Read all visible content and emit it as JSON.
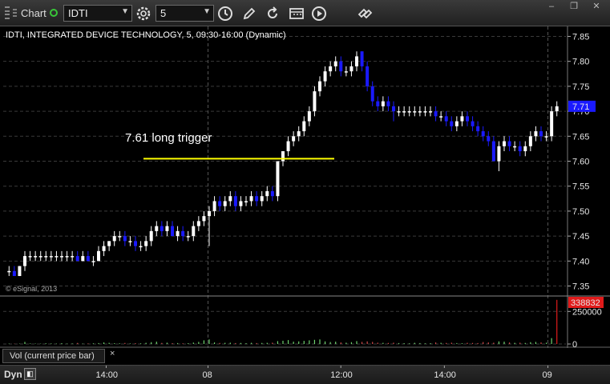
{
  "toolbar": {
    "chart_label": "Chart",
    "symbol": "IDTI",
    "interval": "5",
    "icons": [
      "gear-icon",
      "clock-icon",
      "pencil-icon",
      "refresh-icon",
      "calendar-icon",
      "play-icon",
      "link-icon"
    ]
  },
  "chart": {
    "title": "IDTI, INTEGRATED DEVICE TECHNOLOGY, 5, 09:30-16:00 (Dynamic)",
    "copyright": "© eSignal, 2013",
    "annotation": "7.61 long trigger",
    "current_price_label": "7.71",
    "volume_max_label": "338832",
    "volume_title": "Vol (current price bar)",
    "volume_close": "×",
    "dyn_label": "Dyn",
    "dyn_button": "◧"
  },
  "colors": {
    "background": "#000000",
    "up_candle": "#ffffff",
    "down_candle": "#1a1aff",
    "trigger_line": "#ffff00",
    "grid": "#3a3a3a",
    "price_marker": "#1a1aff",
    "volume_marker": "#e01b1b"
  },
  "chart_data": {
    "type": "candlestick",
    "price_axis_ticks": [
      "7.85",
      "7.80",
      "7.75",
      "7.70",
      "7.65",
      "7.60",
      "7.55",
      "7.50",
      "7.45",
      "7.40",
      "7.35"
    ],
    "volume_axis_ticks": [
      "250000",
      "0"
    ],
    "time_axis_ticks": [
      "14:00",
      "08",
      "12:00",
      "14:00",
      "09"
    ],
    "price_range": [
      7.33,
      7.87
    ],
    "volume_range": [
      0,
      350000
    ],
    "trigger_price": 7.605,
    "last_price": 7.71,
    "candles": [
      [
        7.38,
        7.39,
        7.37,
        7.38
      ],
      [
        7.38,
        7.39,
        7.37,
        7.37
      ],
      [
        7.37,
        7.39,
        7.37,
        7.39
      ],
      [
        7.39,
        7.42,
        7.38,
        7.41
      ],
      [
        7.41,
        7.42,
        7.4,
        7.41
      ],
      [
        7.41,
        7.42,
        7.4,
        7.41
      ],
      [
        7.41,
        7.42,
        7.4,
        7.41
      ],
      [
        7.41,
        7.42,
        7.4,
        7.41
      ],
      [
        7.41,
        7.42,
        7.4,
        7.41
      ],
      [
        7.41,
        7.42,
        7.4,
        7.41
      ],
      [
        7.41,
        7.42,
        7.4,
        7.41
      ],
      [
        7.41,
        7.42,
        7.4,
        7.41
      ],
      [
        7.41,
        7.42,
        7.4,
        7.41
      ],
      [
        7.41,
        7.42,
        7.4,
        7.4
      ],
      [
        7.4,
        7.42,
        7.4,
        7.41
      ],
      [
        7.41,
        7.42,
        7.4,
        7.4
      ],
      [
        7.4,
        7.41,
        7.39,
        7.4
      ],
      [
        7.4,
        7.43,
        7.4,
        7.42
      ],
      [
        7.42,
        7.44,
        7.41,
        7.43
      ],
      [
        7.43,
        7.44,
        7.42,
        7.44
      ],
      [
        7.44,
        7.46,
        7.43,
        7.45
      ],
      [
        7.45,
        7.46,
        7.44,
        7.45
      ],
      [
        7.45,
        7.46,
        7.43,
        7.44
      ],
      [
        7.44,
        7.45,
        7.43,
        7.44
      ],
      [
        7.44,
        7.45,
        7.42,
        7.43
      ],
      [
        7.43,
        7.44,
        7.42,
        7.43
      ],
      [
        7.43,
        7.45,
        7.42,
        7.44
      ],
      [
        7.44,
        7.47,
        7.43,
        7.46
      ],
      [
        7.46,
        7.48,
        7.45,
        7.47
      ],
      [
        7.47,
        7.48,
        7.45,
        7.46
      ],
      [
        7.46,
        7.48,
        7.45,
        7.47
      ],
      [
        7.47,
        7.48,
        7.45,
        7.45
      ],
      [
        7.45,
        7.47,
        7.44,
        7.46
      ],
      [
        7.46,
        7.47,
        7.44,
        7.45
      ],
      [
        7.45,
        7.46,
        7.44,
        7.45
      ],
      [
        7.45,
        7.48,
        7.44,
        7.47
      ],
      [
        7.47,
        7.49,
        7.46,
        7.48
      ],
      [
        7.48,
        7.5,
        7.47,
        7.49
      ],
      [
        7.49,
        7.51,
        7.43,
        7.5
      ],
      [
        7.5,
        7.53,
        7.49,
        7.52
      ],
      [
        7.52,
        7.53,
        7.5,
        7.51
      ],
      [
        7.51,
        7.53,
        7.5,
        7.52
      ],
      [
        7.52,
        7.54,
        7.51,
        7.53
      ],
      [
        7.53,
        7.54,
        7.5,
        7.51
      ],
      [
        7.51,
        7.53,
        7.5,
        7.52
      ],
      [
        7.52,
        7.53,
        7.51,
        7.52
      ],
      [
        7.52,
        7.54,
        7.51,
        7.53
      ],
      [
        7.53,
        7.54,
        7.51,
        7.52
      ],
      [
        7.52,
        7.54,
        7.51,
        7.53
      ],
      [
        7.53,
        7.55,
        7.52,
        7.54
      ],
      [
        7.54,
        7.55,
        7.52,
        7.53
      ],
      [
        7.53,
        7.6,
        7.52,
        7.6
      ],
      [
        7.6,
        7.62,
        7.59,
        7.62
      ],
      [
        7.62,
        7.65,
        7.61,
        7.64
      ],
      [
        7.64,
        7.66,
        7.63,
        7.65
      ],
      [
        7.65,
        7.67,
        7.64,
        7.66
      ],
      [
        7.66,
        7.69,
        7.65,
        7.68
      ],
      [
        7.68,
        7.71,
        7.67,
        7.7
      ],
      [
        7.7,
        7.75,
        7.69,
        7.74
      ],
      [
        7.74,
        7.77,
        7.73,
        7.76
      ],
      [
        7.76,
        7.79,
        7.75,
        7.78
      ],
      [
        7.78,
        7.8,
        7.77,
        7.79
      ],
      [
        7.79,
        7.81,
        7.78,
        7.8
      ],
      [
        7.8,
        7.81,
        7.77,
        7.78
      ],
      [
        7.78,
        7.79,
        7.77,
        7.78
      ],
      [
        7.78,
        7.8,
        7.77,
        7.79
      ],
      [
        7.79,
        7.82,
        7.78,
        7.81
      ],
      [
        7.82,
        7.82,
        7.78,
        7.79
      ],
      [
        7.79,
        7.8,
        7.74,
        7.75
      ],
      [
        7.75,
        7.76,
        7.71,
        7.72
      ],
      [
        7.72,
        7.73,
        7.7,
        7.71
      ],
      [
        7.71,
        7.73,
        7.7,
        7.72
      ],
      [
        7.72,
        7.73,
        7.7,
        7.71
      ],
      [
        7.71,
        7.72,
        7.68,
        7.7
      ],
      [
        7.7,
        7.71,
        7.69,
        7.7
      ],
      [
        7.7,
        7.71,
        7.69,
        7.7
      ],
      [
        7.7,
        7.71,
        7.69,
        7.7
      ],
      [
        7.7,
        7.71,
        7.69,
        7.7
      ],
      [
        7.7,
        7.71,
        7.69,
        7.7
      ],
      [
        7.7,
        7.71,
        7.69,
        7.7
      ],
      [
        7.7,
        7.71,
        7.69,
        7.7
      ],
      [
        7.7,
        7.71,
        7.68,
        7.69
      ],
      [
        7.69,
        7.7,
        7.68,
        7.69
      ],
      [
        7.69,
        7.7,
        7.67,
        7.68
      ],
      [
        7.68,
        7.69,
        7.66,
        7.67
      ],
      [
        7.67,
        7.69,
        7.66,
        7.68
      ],
      [
        7.68,
        7.7,
        7.67,
        7.69
      ],
      [
        7.69,
        7.7,
        7.67,
        7.68
      ],
      [
        7.68,
        7.69,
        7.66,
        7.67
      ],
      [
        7.67,
        7.68,
        7.65,
        7.66
      ],
      [
        7.66,
        7.67,
        7.64,
        7.65
      ],
      [
        7.65,
        7.66,
        7.63,
        7.64
      ],
      [
        7.64,
        7.65,
        7.6,
        7.6
      ],
      [
        7.6,
        7.64,
        7.58,
        7.63
      ],
      [
        7.63,
        7.65,
        7.62,
        7.64
      ],
      [
        7.64,
        7.65,
        7.62,
        7.63
      ],
      [
        7.63,
        7.64,
        7.62,
        7.63
      ],
      [
        7.63,
        7.64,
        7.61,
        7.62
      ],
      [
        7.62,
        7.64,
        7.61,
        7.63
      ],
      [
        7.63,
        7.66,
        7.62,
        7.65
      ],
      [
        7.65,
        7.67,
        7.64,
        7.66
      ],
      [
        7.66,
        7.67,
        7.64,
        7.65
      ],
      [
        7.65,
        7.66,
        7.64,
        7.65
      ],
      [
        7.65,
        7.71,
        7.64,
        7.7
      ],
      [
        7.7,
        7.72,
        7.69,
        7.71
      ]
    ],
    "volume": [
      3000,
      2000,
      2500,
      16000,
      4000,
      3000,
      2500,
      5000,
      4000,
      3000,
      6000,
      3000,
      4000,
      8000,
      3000,
      4000,
      5000,
      7000,
      12000,
      9000,
      6000,
      5000,
      8000,
      4000,
      6000,
      5000,
      9000,
      14000,
      18000,
      8000,
      10000,
      6000,
      7000,
      5000,
      6000,
      11000,
      16000,
      28000,
      35000,
      12000,
      8000,
      9000,
      10000,
      7000,
      8000,
      6000,
      9000,
      7000,
      8000,
      9000,
      10000,
      22000,
      25000,
      30000,
      18000,
      20000,
      24000,
      28000,
      32000,
      35000,
      20000,
      15000,
      18000,
      12000,
      10000,
      14000,
      22000,
      16000,
      20000,
      16000,
      10000,
      9000,
      8000,
      10000,
      7000,
      6000,
      5000,
      9000,
      7000,
      5000,
      6000,
      12000,
      9000,
      8000,
      10000,
      7000,
      6000,
      9000,
      8000,
      7000,
      15000,
      12000,
      10000,
      20000,
      18000,
      12000,
      9000,
      10000,
      8000,
      14000,
      16000,
      12000,
      10000,
      45000,
      338832
    ]
  }
}
